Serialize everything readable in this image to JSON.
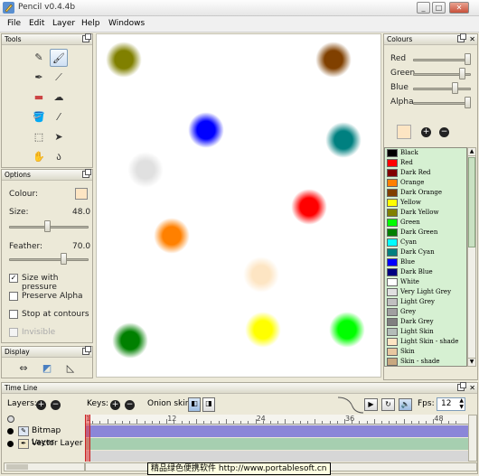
{
  "window": {
    "title": "Pencil v0.4.4b",
    "minimize": "_",
    "maximize": "□",
    "close": "✕"
  },
  "menu": [
    "File",
    "Edit",
    "Layer",
    "Help",
    "Windows"
  ],
  "tools": {
    "title": "Tools"
  },
  "options": {
    "title": "Options",
    "colour_label": "Colour:",
    "colour": "#fde5c3",
    "size_label": "Size:",
    "size_value": "48.0",
    "size_fraction": 0.48,
    "feather_label": "Feather:",
    "feather_value": "70.0",
    "feather_fraction": 0.7,
    "checks": [
      {
        "label": "Size with pressure",
        "checked": true,
        "disabled": false
      },
      {
        "label": "Preserve Alpha",
        "checked": false,
        "disabled": false
      },
      {
        "label": "Stop at contours",
        "checked": false,
        "disabled": false
      },
      {
        "label": "Invisible",
        "checked": false,
        "disabled": true
      }
    ]
  },
  "display": {
    "title": "Display"
  },
  "colours": {
    "title": "Colours",
    "channels": [
      {
        "label": "Red",
        "fraction": 1.0
      },
      {
        "label": "Green",
        "fraction": 0.9
      },
      {
        "label": "Blue",
        "fraction": 0.75
      },
      {
        "label": "Alpha",
        "fraction": 1.0
      }
    ],
    "current": "#fde5c3",
    "add": "+",
    "remove": "−",
    "palette": [
      {
        "name": "Black",
        "color": "#000000"
      },
      {
        "name": "Red",
        "color": "#ff0000"
      },
      {
        "name": "Dark Red",
        "color": "#800000"
      },
      {
        "name": "Orange",
        "color": "#ff8000"
      },
      {
        "name": "Dark Orange",
        "color": "#804000"
      },
      {
        "name": "Yellow",
        "color": "#ffff00"
      },
      {
        "name": "Dark Yellow",
        "color": "#808000"
      },
      {
        "name": "Green",
        "color": "#00ff00"
      },
      {
        "name": "Dark Green",
        "color": "#008000"
      },
      {
        "name": "Cyan",
        "color": "#00ffff"
      },
      {
        "name": "Dark Cyan",
        "color": "#008080"
      },
      {
        "name": "Blue",
        "color": "#0000ff"
      },
      {
        "name": "Dark Blue",
        "color": "#000080"
      },
      {
        "name": "White",
        "color": "#ffffff"
      },
      {
        "name": "Very Light Grey",
        "color": "#e0e0e0"
      },
      {
        "name": "Light Grey",
        "color": "#c0c0c0"
      },
      {
        "name": "Grey",
        "color": "#a0a0a0"
      },
      {
        "name": "Dark Grey",
        "color": "#808080"
      },
      {
        "name": "Light Skin",
        "color": "#b3bdb8"
      },
      {
        "name": "Light Skin - shade",
        "color": "#fde5c3"
      },
      {
        "name": "Skin",
        "color": "#e8c8a0"
      },
      {
        "name": "Skin - shade",
        "color": "#c8a880"
      }
    ]
  },
  "canvas_blobs": [
    {
      "color": "#808000"
    },
    {
      "color": "#804000"
    },
    {
      "color": "#0000ff"
    },
    {
      "color": "#008080"
    },
    {
      "color": "#e0e0e0"
    },
    {
      "color": "#ff0000"
    },
    {
      "color": "#ff8000"
    },
    {
      "color": "#fde5c3"
    },
    {
      "color": "#008000"
    },
    {
      "color": "#ffff00"
    },
    {
      "color": "#00ff00"
    }
  ],
  "timeline": {
    "title": "Time Line",
    "layers_label": "Layers:",
    "keys_label": "Keys:",
    "onion_label": "Onion skin:",
    "fps_label": "Fps:",
    "fps_value": "12",
    "frame_ticks": [
      "1",
      "12",
      "24",
      "36",
      "48"
    ],
    "layers": [
      {
        "name": "Bitmap Layer",
        "color": "#8b86d8"
      },
      {
        "name": "Vector Layer",
        "color": "#a6cfb0"
      }
    ]
  },
  "status_text": "精品绿色便携软件 http://www.portablesoft.cn"
}
